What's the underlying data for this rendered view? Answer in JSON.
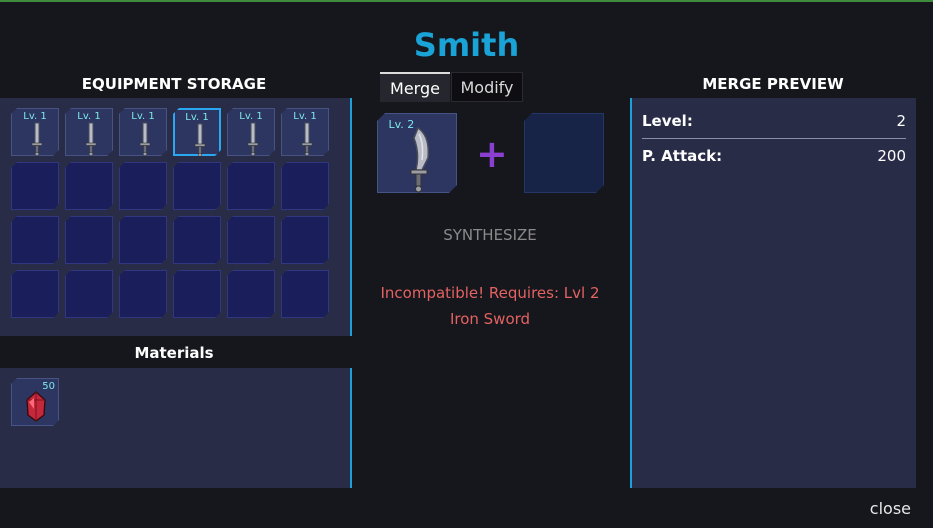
{
  "title": "Smith",
  "storage": {
    "header": "EQUIPMENT STORAGE",
    "items": [
      {
        "level": "Lv. 1",
        "selected": false
      },
      {
        "level": "Lv. 1",
        "selected": false
      },
      {
        "level": "Lv. 1",
        "selected": false
      },
      {
        "level": "Lv. 1",
        "selected": true
      },
      {
        "level": "Lv. 1",
        "selected": false
      },
      {
        "level": "Lv. 1",
        "selected": false
      }
    ],
    "rows": 4,
    "cols": 6
  },
  "materials": {
    "header": "Materials",
    "items": [
      {
        "count": "50",
        "icon": "red-crystal-icon"
      }
    ]
  },
  "tabs": [
    {
      "label": "Merge",
      "active": true
    },
    {
      "label": "Modify",
      "active": false
    }
  ],
  "merge": {
    "left_slot_level": "Lv. 2",
    "plus": "+",
    "synthesize_label": "SYNTHESIZE",
    "error_line1": "Incompatible! Requires: Lvl 2",
    "error_line2": "Iron Sword"
  },
  "preview": {
    "header": "MERGE PREVIEW",
    "stats": [
      {
        "label": "Level:",
        "value": "2"
      },
      {
        "label": "P. Attack:",
        "value": "200"
      }
    ]
  },
  "close_label": "close",
  "colors": {
    "accent": "#1e9fd8",
    "title": "#1aa3d6",
    "error": "#e36262",
    "level_text": "#7de8e8",
    "plus": "#8a3fd0"
  }
}
